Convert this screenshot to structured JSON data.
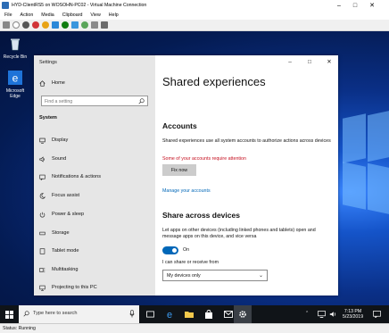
{
  "vm": {
    "title": "HYD-ClientRS5 on WOSOHN-PC02 - Virtual Machine Connection",
    "menu": [
      "File",
      "Action",
      "Media",
      "Clipboard",
      "View",
      "Help"
    ],
    "status": "Status: Running"
  },
  "desktop": {
    "icons": [
      {
        "label": "Recycle Bin",
        "icon": "recycle-bin-icon"
      },
      {
        "label": "Microsoft Edge",
        "icon": "edge-icon"
      }
    ]
  },
  "settings": {
    "window_title": "Settings",
    "home_label": "Home",
    "search_placeholder": "Find a setting",
    "section": "System",
    "nav": [
      {
        "label": "Display",
        "icon": "display-icon"
      },
      {
        "label": "Sound",
        "icon": "sound-icon"
      },
      {
        "label": "Notifications & actions",
        "icon": "notifications-icon"
      },
      {
        "label": "Focus assist",
        "icon": "moon-icon"
      },
      {
        "label": "Power & sleep",
        "icon": "power-icon"
      },
      {
        "label": "Storage",
        "icon": "storage-icon"
      },
      {
        "label": "Tablet mode",
        "icon": "tablet-icon"
      },
      {
        "label": "Multitasking",
        "icon": "multitasking-icon"
      },
      {
        "label": "Projecting to this PC",
        "icon": "projecting-icon"
      }
    ],
    "page_title": "Shared experiences",
    "accounts_heading": "Accounts",
    "accounts_desc": "Shared experiences use all system accounts to authorize actions across devices",
    "accounts_warning": "Some of your accounts require attention",
    "fix_button": "Fix now",
    "manage_link": "Manage your accounts",
    "share_heading": "Share across devices",
    "share_desc": "Let apps on other devices (including linked phones and tablets) open and message apps on this device, and vice versa",
    "toggle_state": "On",
    "share_with_label": "I can share or receive from",
    "share_with_value": "My devices only"
  },
  "taskbar": {
    "search_placeholder": "Type here to search",
    "time": "7:13 PM",
    "date": "5/23/2019"
  },
  "colors": {
    "accent": "#0067b8",
    "warning": "#c50f1f"
  }
}
